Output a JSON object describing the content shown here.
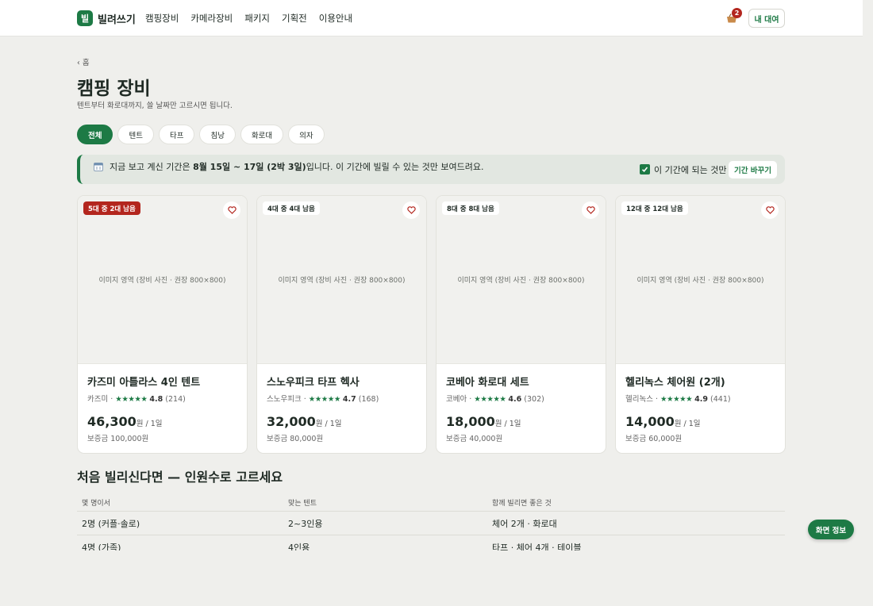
{
  "header": {
    "logo_char": "빌",
    "brand": "빌려쓰기",
    "nav": [
      "캠핑장비",
      "카메라장비",
      "패키지",
      "기획전",
      "이용안내"
    ],
    "cart_count": "2",
    "my_rent_label": "내 대여"
  },
  "breadcrumb": "‹ 홈",
  "page": {
    "title": "캠핑 장비",
    "subtitle": "텐트부터 화로대까지, 쓸 날짜만 고르시면 됩니다."
  },
  "filters": {
    "chips": [
      "전체",
      "텐트",
      "타프",
      "침낭",
      "화로대",
      "의자"
    ],
    "active": "전체"
  },
  "period_banner": {
    "text_before": "지금 보고 계신 기간은 ",
    "period": "8월 15일 ~ 17일 (2박 3일)",
    "text_after": "입니다. 이 기간에 빌릴 수 있는 것만 보여드려요.",
    "checkbox_label": "이 기간에 되는 것만",
    "checkbox_checked": true,
    "change_button": "기간 바꾸기"
  },
  "products": [
    {
      "stock": "5대 중 2대 남음",
      "low_stock": true,
      "image_placeholder": "이미지 영역 (장비 사진 · 권장 800×800)",
      "name": "카즈미 아틀라스 4인 텐트",
      "brand": "카즈미",
      "stars": "★★★★★",
      "rating": "4.8",
      "reviews": "(214)",
      "price": "46,300",
      "price_unit": "원 / 1일",
      "deposit": "보증금 100,000원"
    },
    {
      "stock": "4대 중 4대 남음",
      "low_stock": false,
      "image_placeholder": "이미지 영역 (장비 사진 · 권장 800×800)",
      "name": "스노우피크 타프 헥사",
      "brand": "스노우피크",
      "stars": "★★★★★",
      "rating": "4.7",
      "reviews": "(168)",
      "price": "32,000",
      "price_unit": "원 / 1일",
      "deposit": "보증금 80,000원"
    },
    {
      "stock": "8대 중 8대 남음",
      "low_stock": false,
      "image_placeholder": "이미지 영역 (장비 사진 · 권장 800×800)",
      "name": "코베아 화로대 세트",
      "brand": "코베아",
      "stars": "★★★★★",
      "rating": "4.6",
      "reviews": "(302)",
      "price": "18,000",
      "price_unit": "원 / 1일",
      "deposit": "보증금 40,000원"
    },
    {
      "stock": "12대 중 12대 남음",
      "low_stock": false,
      "image_placeholder": "이미지 영역 (장비 사진 · 권장 800×800)",
      "name": "헬리녹스 체어원 (2개)",
      "brand": "헬리녹스",
      "stars": "★★★★★",
      "rating": "4.9",
      "reviews": "(441)",
      "price": "14,000",
      "price_unit": "원 / 1일",
      "deposit": "보증금 60,000원"
    }
  ],
  "guide": {
    "title": "처음 빌리신다면 — 인원수로 고르세요",
    "headers": [
      "몇 명이서",
      "맞는 텐트",
      "함께 빌리면 좋은 것"
    ],
    "rows": [
      [
        "2명 (커플·솔로)",
        "2~3인용",
        "체어 2개 · 화로대"
      ],
      [
        "4명 (가족)",
        "4인용",
        "타프 · 체어 4개 · 테이블"
      ]
    ]
  },
  "screen_info_button": "화면 정보",
  "colors": {
    "accent": "#1d7a45",
    "alert": "#b3261e",
    "background": "#efefec"
  }
}
